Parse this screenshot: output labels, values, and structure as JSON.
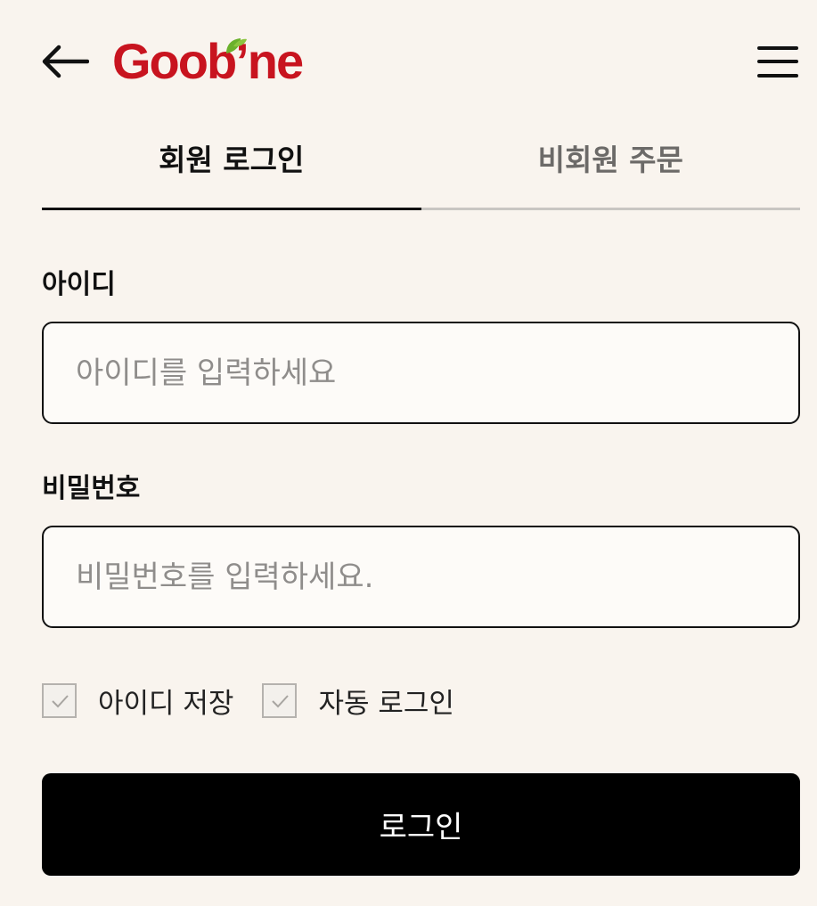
{
  "header": {
    "back_icon": "arrow-left-icon",
    "logo_text": "Goob’ne",
    "menu_icon": "hamburger-menu-icon",
    "brand_color": "#c8141f",
    "leaf_color": "#6bb12c"
  },
  "tabs": [
    {
      "label": "회원 로그인",
      "active": true
    },
    {
      "label": "비회원 주문",
      "active": false
    }
  ],
  "form": {
    "id_label": "아이디",
    "id_placeholder": "아이디를 입력하세요",
    "id_value": "",
    "password_label": "비밀번호",
    "password_placeholder": "비밀번호를 입력하세요.",
    "password_value": ""
  },
  "options": [
    {
      "label": "아이디 저장",
      "icon": "checkmark-icon"
    },
    {
      "label": "자동 로그인",
      "icon": "checkmark-icon"
    }
  ],
  "login_button_label": "로그인"
}
